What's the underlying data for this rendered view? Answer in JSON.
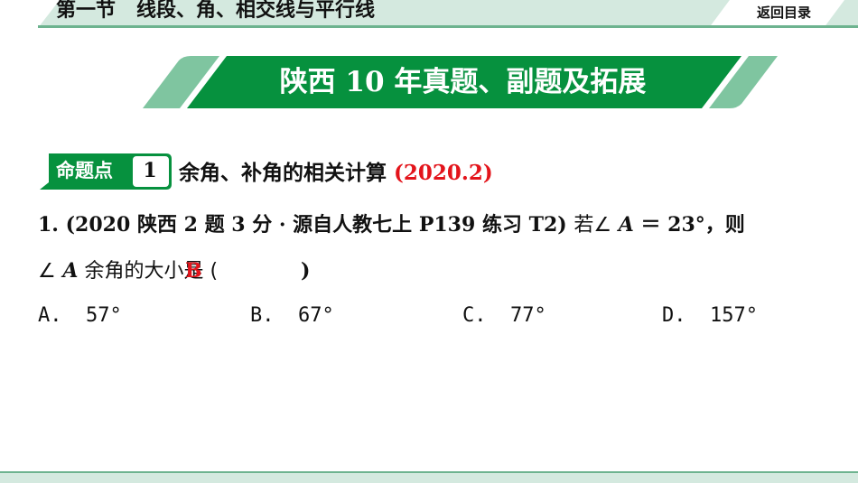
{
  "header": {
    "section_title": "第一节   线段、角、相交线与平行线",
    "back_link": "返回目录"
  },
  "banner": {
    "title": "陕西 10 年真题、副题及拓展"
  },
  "topic": {
    "badge_label": "命题点",
    "badge_number": "1",
    "title": "余角、补角的相关计算",
    "year_tag": "(2020.2)"
  },
  "question": {
    "number": "1.",
    "source": "(2020 陕西 2 题 3 分 · 源自人教七上 P139 练习 T2)",
    "stem_part1": "若∠",
    "var": "A",
    "stem_part2": " ＝ 23°，则",
    "line2_prefix": "∠",
    "line2_var": "A",
    "line2_text": " 余角的大小是 (",
    "line2_close": ")",
    "answer": "B",
    "options": [
      {
        "label": "A.",
        "value": "57°"
      },
      {
        "label": "B.",
        "value": "67°"
      },
      {
        "label": "C.",
        "value": "77°"
      },
      {
        "label": "D.",
        "value": "157°"
      }
    ]
  },
  "colors": {
    "primary_green": "#06913e",
    "light_green": "#7fc5a0",
    "mint": "#d4e9df",
    "line_green": "#6db38f",
    "answer_red": "#e3141b"
  }
}
